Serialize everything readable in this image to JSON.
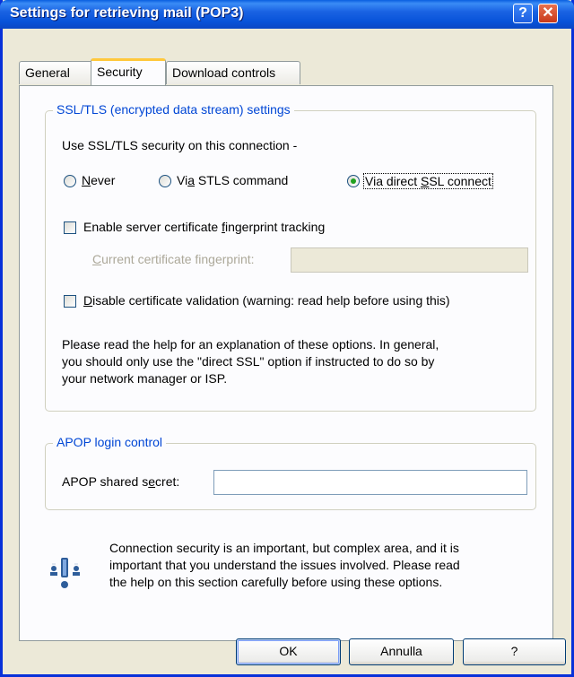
{
  "window": {
    "title": "Settings for retrieving mail (POP3)"
  },
  "titlebar_buttons": {
    "help": "?",
    "close": "✕"
  },
  "tabs": [
    {
      "label": "General"
    },
    {
      "label": "Security"
    },
    {
      "label": "Download controls"
    }
  ],
  "ssl": {
    "group_title": "SSL/TLS (encrypted data stream) settings",
    "use_label": "Use SSL/TLS security on this connection -",
    "options": [
      {
        "pre": "",
        "key": "N",
        "post": "ever",
        "selected": false
      },
      {
        "pre": "Vi",
        "key": "a",
        "post": " STLS command",
        "selected": false
      },
      {
        "pre": "Via direct ",
        "key": "S",
        "post": "SL connect",
        "selected": true
      }
    ],
    "fingerprint_tracking": {
      "pre": "Enable server certificate ",
      "key": "f",
      "post": "ingerprint tracking",
      "checked": false
    },
    "current_fingerprint": {
      "key": "C",
      "post": "urrent certificate fingerprint:",
      "value": ""
    },
    "disable_validation": {
      "key": "D",
      "post": "isable certificate validation (warning: read help before using this)",
      "checked": false
    },
    "help_text": [
      "Please read the help for an explanation of these options. In general,",
      "you should only use the \"direct SSL\" option if instructed to do so by",
      "your network manager or ISP."
    ]
  },
  "apop": {
    "group_title": "APOP login control",
    "secret": {
      "pre": "APOP shared s",
      "key": "e",
      "post": "cret:",
      "value": ""
    }
  },
  "notice": {
    "icon": "security-warning-icon",
    "lines": [
      "Connection security is an important, but complex area, and it is",
      "important that you understand the issues involved. Please read",
      "the help on this section carefully before using these options."
    ]
  },
  "buttons": {
    "ok": "OK",
    "cancel": "Annulla",
    "help": "?"
  },
  "colors": {
    "titlebar": "#0a5fe0",
    "group_title": "#0046d5",
    "dialog_bg": "#ece9d8",
    "radio_selected": "#21a121"
  }
}
